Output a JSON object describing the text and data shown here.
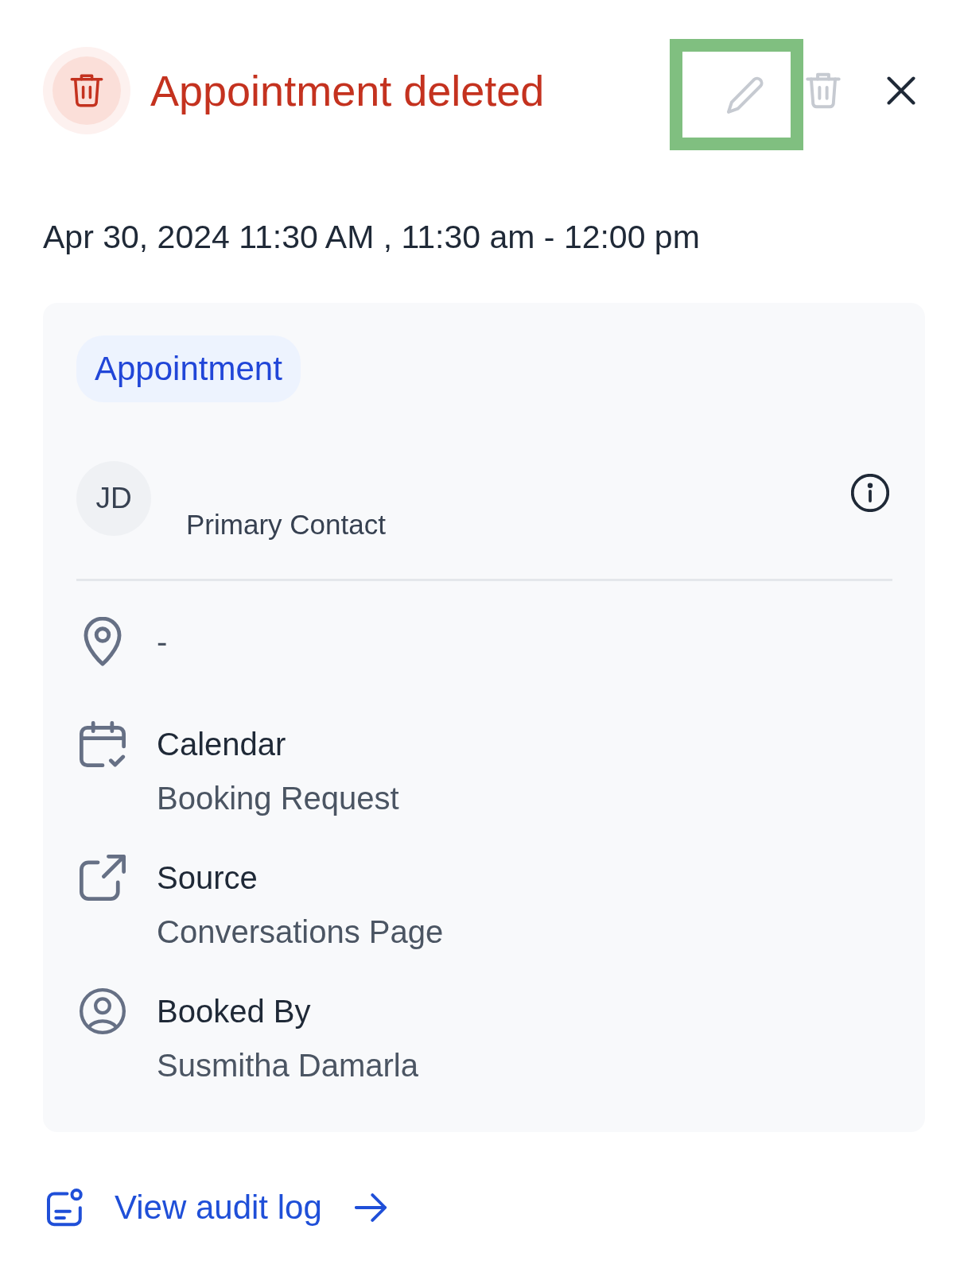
{
  "header": {
    "deleted": true,
    "title": "Appointment deleted"
  },
  "actions": [
    {
      "kind": "edit",
      "disabled": true,
      "highlighted": true
    },
    {
      "kind": "delete",
      "disabled": true,
      "highlighted": false
    },
    {
      "kind": "close",
      "disabled": false,
      "highlighted": false
    }
  ],
  "datetime": "Apr 30, 2024 11:30 AM , 11:30 am - 12:00 pm",
  "card": {
    "tag": "Appointment",
    "contact": {
      "initials": "JD",
      "role": "Primary Contact"
    },
    "details": [
      {
        "kind": "location",
        "value": "-"
      },
      {
        "kind": "calendar",
        "label": "Calendar",
        "value": "Booking Request"
      },
      {
        "kind": "source",
        "label": "Source",
        "value": "Conversations Page"
      },
      {
        "kind": "booked_by",
        "label": "Booked By",
        "value": "Susmitha Damarla"
      }
    ]
  },
  "footer": {
    "link": "View audit log"
  }
}
